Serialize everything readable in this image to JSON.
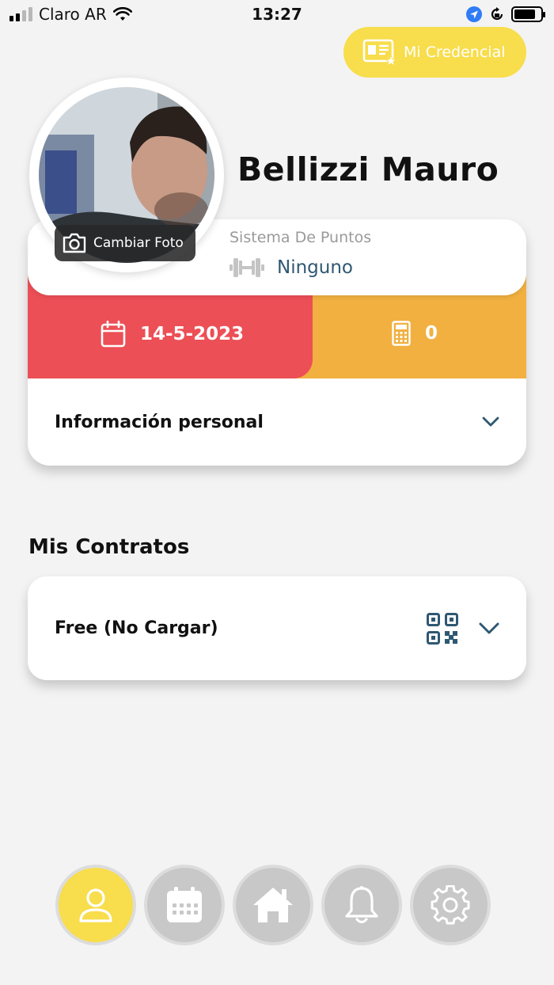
{
  "status_bar": {
    "carrier": "Claro AR",
    "time": "13:27"
  },
  "header": {
    "credential_label": "Mi Credencial"
  },
  "profile": {
    "name": "Bellizzi Mauro",
    "change_photo_label": "Cambiar Foto",
    "points_system_label": "Sistema De Puntos",
    "points_system_value": "Ninguno",
    "date": "14-5-2023",
    "count": "0",
    "personal_info_label": "Información personal"
  },
  "contracts": {
    "title": "Mis Contratos",
    "items": [
      {
        "label": "Free (No Cargar)"
      }
    ]
  },
  "bottom_nav": {
    "items": [
      {
        "icon": "user-icon",
        "active": true
      },
      {
        "icon": "calendar-icon",
        "active": false
      },
      {
        "icon": "home-icon",
        "active": false
      },
      {
        "icon": "bell-icon",
        "active": false
      },
      {
        "icon": "gear-icon",
        "active": false
      }
    ]
  },
  "colors": {
    "accent_yellow": "#f8dd4c",
    "date_red": "#ec4f56",
    "count_orange": "#f1b040",
    "text_blue": "#2f5872"
  }
}
